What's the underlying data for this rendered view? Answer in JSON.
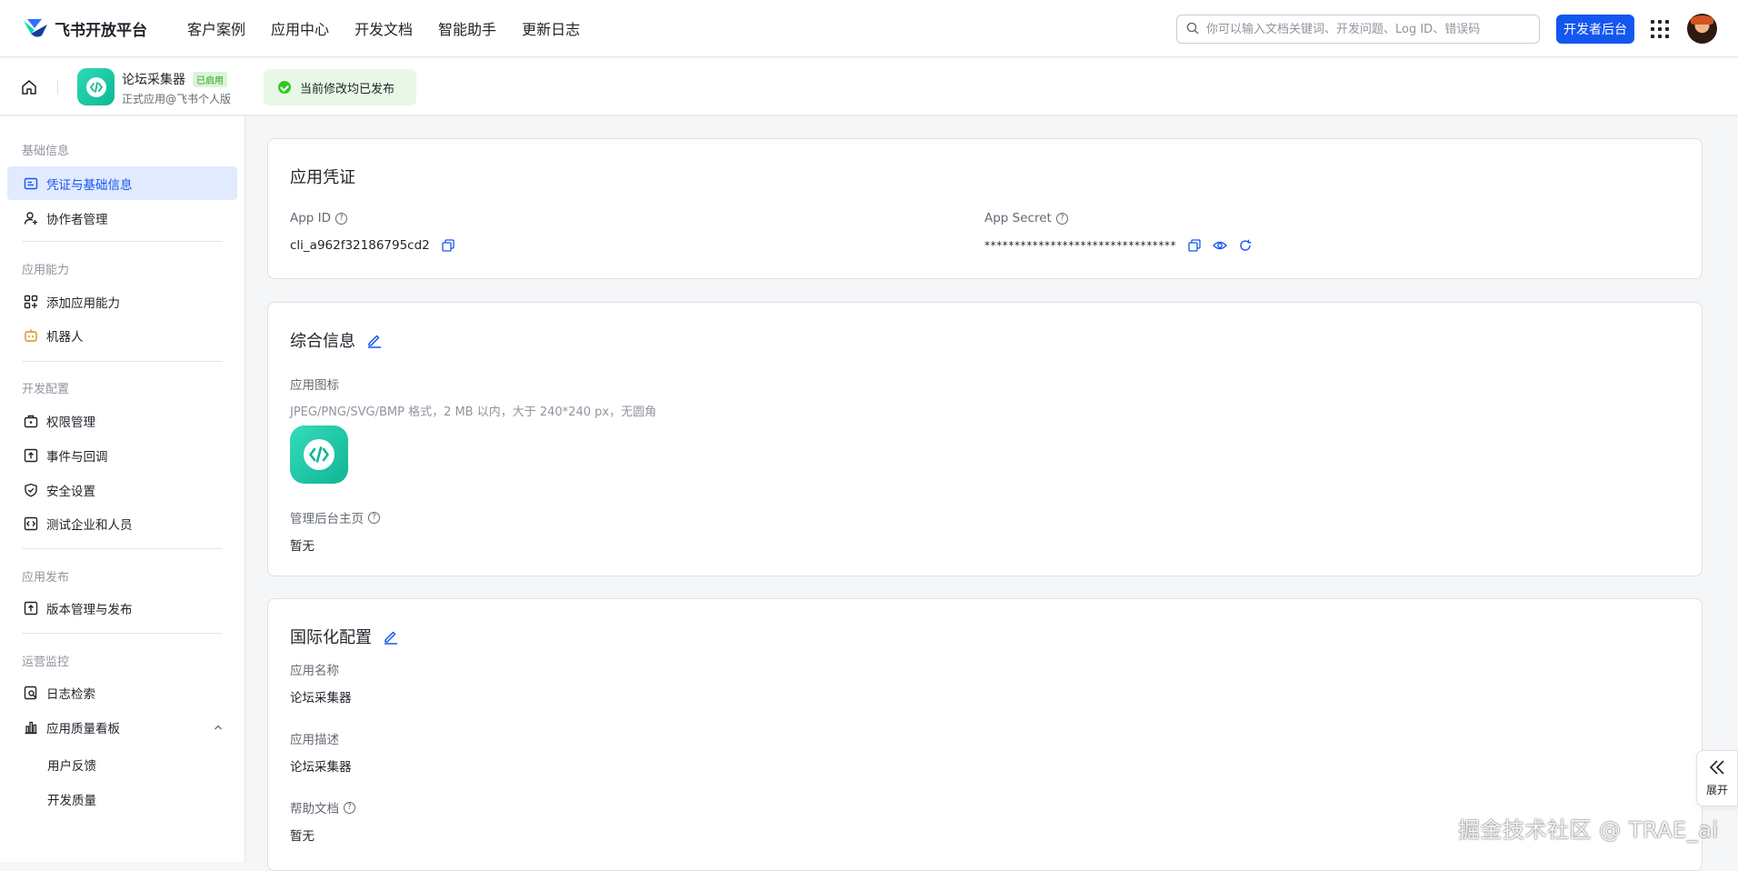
{
  "brand": {
    "name": "飞书开放平台"
  },
  "nav": [
    "客户案例",
    "应用中心",
    "开发文档",
    "智能助手",
    "更新日志"
  ],
  "search": {
    "placeholder": "你可以输入文档关键词、开发问题、Log ID、错误码"
  },
  "header": {
    "dev_console_label": "开发者后台"
  },
  "app": {
    "name": "论坛采集器",
    "status": "已启用",
    "subtitle": "正式应用@飞书个人版",
    "publish_status": "当前修改均已发布"
  },
  "sidebar": {
    "groups": [
      {
        "title": "基础信息",
        "items": [
          "凭证与基础信息",
          "协作者管理"
        ]
      },
      {
        "title": "应用能力",
        "items": [
          "添加应用能力",
          "机器人"
        ]
      },
      {
        "title": "开发配置",
        "items": [
          "权限管理",
          "事件与回调",
          "安全设置",
          "测试企业和人员"
        ]
      },
      {
        "title": "应用发布",
        "items": [
          "版本管理与发布"
        ]
      },
      {
        "title": "运营监控",
        "items": [
          "日志检索",
          "应用质量看板"
        ]
      }
    ],
    "sub_items": [
      "用户反馈",
      "开发质量"
    ]
  },
  "credentials": {
    "title": "应用凭证",
    "app_id_label": "App ID",
    "app_id": "cli_a962f32186795cd2",
    "app_secret_label": "App Secret",
    "app_secret": "********************************"
  },
  "general": {
    "title": "综合信息",
    "icon_label": "应用图标",
    "icon_hint": "JPEG/PNG/SVG/BMP 格式，2 MB 以内，大于 240*240 px，无圆角",
    "admin_home_label": "管理后台主页",
    "admin_home_value": "暂无"
  },
  "i18n": {
    "title": "国际化配置",
    "name_label": "应用名称",
    "name_value": "论坛采集器",
    "desc_label": "应用描述",
    "desc_value": "论坛采集器",
    "help_label": "帮助文档",
    "help_value": "暂无"
  },
  "expand": {
    "label": "展开"
  },
  "watermark": "掘金技术社区 @ TRAE_ai",
  "colors": {
    "primary": "#1456f0",
    "active_bg": "#e1eaff",
    "success": "#34c724",
    "app_icon": "#1fc8a5"
  }
}
